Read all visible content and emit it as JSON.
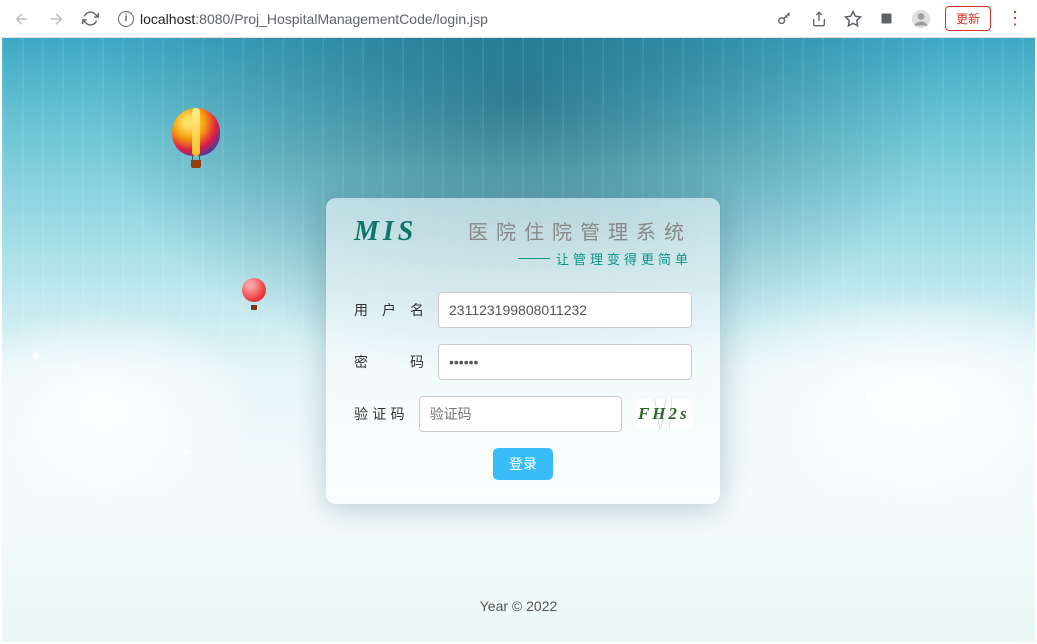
{
  "browser": {
    "url_full": "localhost:8080/Proj_HospitalManagementCode/login.jsp",
    "url_host": "localhost",
    "url_port_path": ":8080/Proj_HospitalManagementCode/login.jsp",
    "update_label": "更新"
  },
  "card": {
    "logo": "MIS",
    "title": "医院住院管理系统",
    "subtitle": "让管理变得更简单"
  },
  "form": {
    "username_label": "用户名",
    "username_value": "231123199808011232",
    "password_label": "密 码",
    "password_value": "••••••",
    "captcha_label": "验证码",
    "captcha_placeholder": "验证码",
    "captcha_image_text": "FH2s",
    "login_button": "登录"
  },
  "footer": {
    "text": "Year © 2022"
  }
}
